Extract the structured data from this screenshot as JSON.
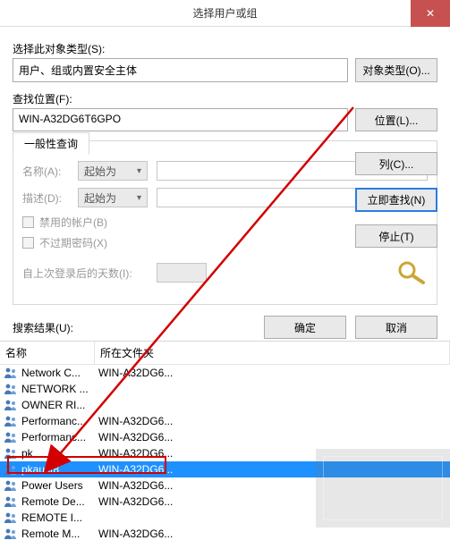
{
  "title": "选择用户或组",
  "close_glyph": "✕",
  "object_type_label": "选择此对象类型(S):",
  "object_type_value": "用户、组或内置安全主体",
  "object_type_button": "对象类型(O)...",
  "location_label": "查找位置(F):",
  "location_value": "WIN-A32DG6T6GPO",
  "location_button": "位置(L)...",
  "common_query_tab": "一般性查询",
  "name_label": "名称(A):",
  "desc_label": "描述(D):",
  "starts_with": "起始为",
  "disabled_accounts": "禁用的帐户(B)",
  "no_expire_pw": "不过期密码(X)",
  "days_since_logon": "自上次登录后的天数(I):",
  "columns_btn": "列(C)...",
  "find_now_btn": "立即查找(N)",
  "stop_btn": "停止(T)",
  "ok_btn": "确定",
  "cancel_btn": "取消",
  "results_label": "搜索结果(U):",
  "col_name": "名称",
  "col_folder": "所在文件夹",
  "rows": [
    {
      "name": "Network C...",
      "folder": "WIN-A32DG6...",
      "selected": false
    },
    {
      "name": "NETWORK ...",
      "folder": "",
      "selected": false
    },
    {
      "name": "OWNER RI...",
      "folder": "",
      "selected": false
    },
    {
      "name": "Performanc...",
      "folder": "WIN-A32DG6...",
      "selected": false
    },
    {
      "name": "Performanc...",
      "folder": "WIN-A32DG6...",
      "selected": false
    },
    {
      "name": "pk",
      "folder": "WIN-A32DG6...",
      "selected": false
    },
    {
      "name": "pkaust8",
      "folder": "WIN-A32DG6...",
      "selected": true
    },
    {
      "name": "Power Users",
      "folder": "WIN-A32DG6...",
      "selected": false
    },
    {
      "name": "Remote De...",
      "folder": "WIN-A32DG6...",
      "selected": false
    },
    {
      "name": "REMOTE I...",
      "folder": "",
      "selected": false
    },
    {
      "name": "Remote M...",
      "folder": "WIN-A32DG6...",
      "selected": false
    }
  ]
}
